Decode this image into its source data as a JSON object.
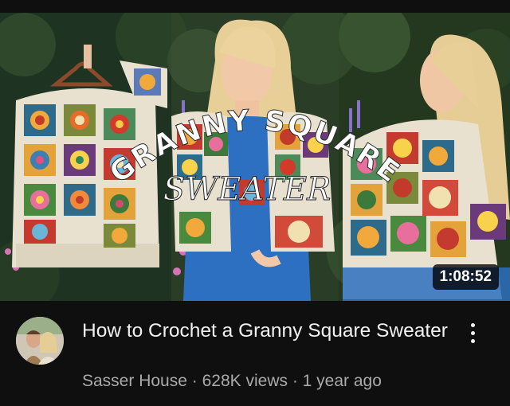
{
  "video": {
    "overlay_line1": "GRANNY SQUARE",
    "overlay_line2": "SWEATER",
    "duration": "1:08:52",
    "title": "How to Crochet a Granny Square Sweater",
    "channel": "Sasser House",
    "views": "628K views",
    "age": "1 year ago",
    "separator": "·"
  },
  "colors": {
    "background": "#0f0f0f",
    "title_text": "#f1f1f1",
    "secondary_text": "#aaaaaa"
  }
}
